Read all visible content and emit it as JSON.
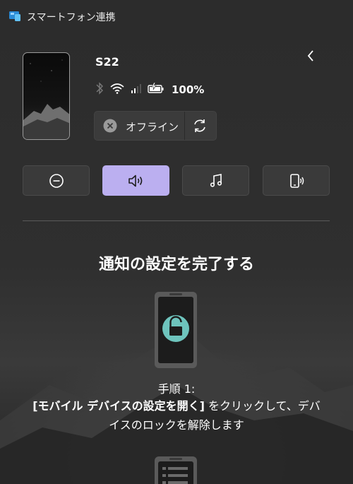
{
  "app": {
    "title": "スマートフォン連携",
    "icon": "phone-link-app-icon"
  },
  "device": {
    "name": "S22",
    "battery": "100%",
    "status_icons": [
      "bluetooth-icon",
      "wifi-icon",
      "signal-icon",
      "battery-charging-icon"
    ],
    "connection": {
      "label": "オフライン",
      "state_icon": "offline-x-icon",
      "refresh_icon": "refresh-icon"
    }
  },
  "quick_actions": [
    {
      "icon": "do-not-disturb-icon",
      "active": false
    },
    {
      "icon": "volume-icon",
      "active": true
    },
    {
      "icon": "music-icon",
      "active": false
    },
    {
      "icon": "ring-phone-icon",
      "active": false
    }
  ],
  "setup": {
    "heading": "通知の設定を完了する",
    "step_title": "手順 1:",
    "step_text_bold": "[モバイル デバイスの設定を開く]",
    "step_text_rest": " をクリックして、デバイスのロックを解除します"
  },
  "colors": {
    "accent": "#bbaff0",
    "lock_teal": "#6ec4bd",
    "background": "#2c2c2c"
  }
}
